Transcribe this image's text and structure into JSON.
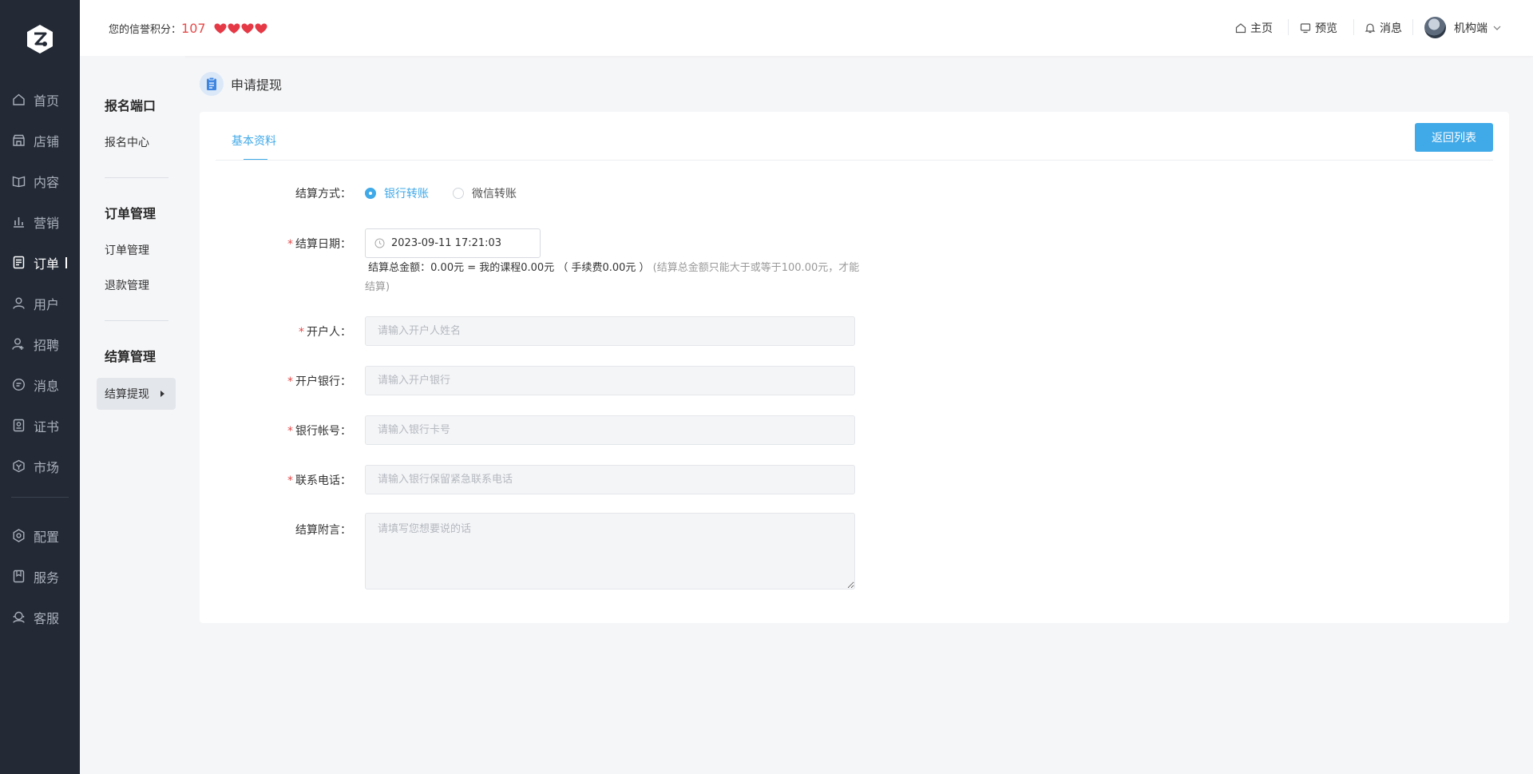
{
  "header": {
    "credit_label": "您的信誉积分：",
    "credit_score": "107",
    "hearts_count": 4,
    "tools": [
      {
        "label": "主页",
        "icon": "home-icon"
      },
      {
        "label": "预览",
        "icon": "monitor-icon"
      },
      {
        "label": "消息",
        "icon": "bell-icon"
      }
    ],
    "user_name": "机构端"
  },
  "sidebar": {
    "items": [
      {
        "label": "首页",
        "icon": "home-icon"
      },
      {
        "label": "店铺",
        "icon": "store-icon"
      },
      {
        "label": "内容",
        "icon": "book-icon"
      },
      {
        "label": "营销",
        "icon": "chart-icon"
      },
      {
        "label": "订单",
        "icon": "order-icon",
        "active": true
      },
      {
        "label": "用户",
        "icon": "user-icon"
      },
      {
        "label": "招聘",
        "icon": "recruit-icon"
      },
      {
        "label": "消息",
        "icon": "message-icon"
      },
      {
        "label": "证书",
        "icon": "certificate-icon"
      },
      {
        "label": "市场",
        "icon": "market-icon"
      }
    ],
    "bottom_items": [
      {
        "label": "配置",
        "icon": "gear-icon"
      },
      {
        "label": "服务",
        "icon": "service-icon"
      },
      {
        "label": "客服",
        "icon": "support-icon"
      }
    ]
  },
  "subnav": {
    "groups": [
      {
        "title": "报名端口",
        "items": [
          "报名中心"
        ]
      },
      {
        "title": "订单管理",
        "items": [
          "订单管理",
          "退款管理"
        ]
      },
      {
        "title": "结算管理",
        "items": [
          "结算提现"
        ]
      }
    ]
  },
  "page": {
    "title": "申请提现",
    "tab": "基本资料",
    "back_button": "返回列表"
  },
  "form": {
    "method_label": "结算方式：",
    "method_options": [
      "银行转账",
      "微信转账"
    ],
    "method_selected": "银行转账",
    "date_label": "结算日期：",
    "date_value": "2023-09-11 17:21:03",
    "summary": "结算总金额：0.00元 = 我的课程0.00元 （ 手续费0.00元 ）",
    "summary_hint": "(结算总金额只能大于或等于100.00元，才能结算)",
    "holder_label": "开户人：",
    "holder_placeholder": "请输入开户人姓名",
    "bank_label": "开户银行：",
    "bank_placeholder": "请输入开户银行",
    "account_label": "银行帐号：",
    "account_placeholder": "请输入银行卡号",
    "phone_label": "联系电话：",
    "phone_placeholder": "请输入银行保留紧急联系电话",
    "note_label": "结算附言：",
    "note_placeholder": "请填写您想要说的话"
  },
  "colors": {
    "sidebar_bg": "#232a36",
    "accent": "#40a9e8",
    "required": "#e64a4a",
    "heart": "#e63946"
  }
}
